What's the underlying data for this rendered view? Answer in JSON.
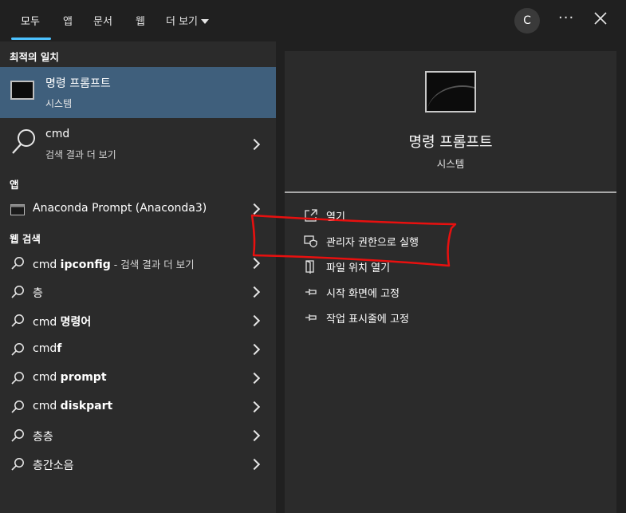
{
  "tabs": [
    "모두",
    "앱",
    "문서",
    "웹",
    "더 보기"
  ],
  "account_initial": "C",
  "more_options_glyph": "···",
  "sections": {
    "best_match": "최적의 일치",
    "apps": "앱",
    "web_search": "웹 검색"
  },
  "best_match": {
    "title": "명령 프롬프트",
    "subtitle": "시스템"
  },
  "search_row": {
    "title": "cmd",
    "subtitle": "검색 결과 더 보기"
  },
  "apps": [
    {
      "label": "Anaconda Prompt (Anaconda3)"
    }
  ],
  "web_results": [
    {
      "normal": "cmd ",
      "bold": "ipconfig",
      "suffix": " - 검색 결과 더 보기"
    },
    {
      "normal": "층",
      "bold": "",
      "suffix": ""
    },
    {
      "normal": "cmd ",
      "bold": "명령어",
      "suffix": ""
    },
    {
      "normal": "cmd",
      "bold": "f",
      "suffix": ""
    },
    {
      "normal": "cmd ",
      "bold": "prompt",
      "suffix": ""
    },
    {
      "normal": "cmd ",
      "bold": "diskpart",
      "suffix": ""
    },
    {
      "normal": "층층",
      "bold": "",
      "suffix": ""
    },
    {
      "normal": "층간소음",
      "bold": "",
      "suffix": ""
    }
  ],
  "detail": {
    "title": "명령 프롬프트",
    "type": "시스템",
    "actions": [
      "열기",
      "관리자 권한으로 실행",
      "파일 위치 열기",
      "시작 화면에 고정",
      "작업 표시줄에 고정"
    ]
  },
  "colors": {
    "selected": "#3f5f7c",
    "accent": "#4cc2ff",
    "annotation": "#e8100f"
  }
}
